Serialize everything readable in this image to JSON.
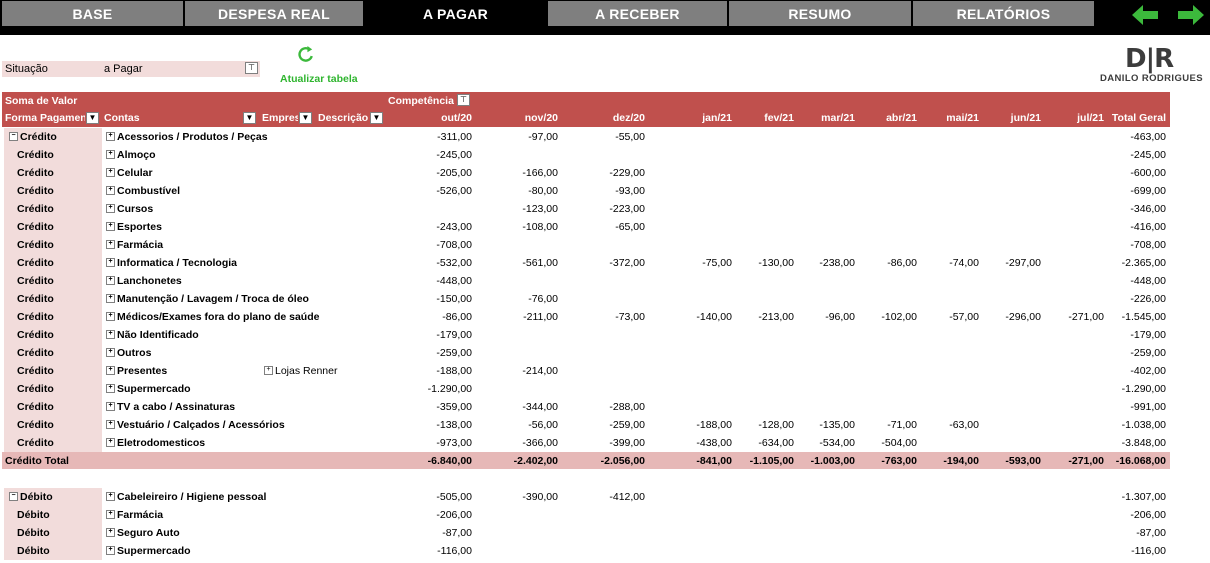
{
  "tabs": [
    {
      "label": "BASE"
    },
    {
      "label": "DESPESA REAL"
    },
    {
      "label": "A PAGAR"
    },
    {
      "label": "A RECEBER"
    },
    {
      "label": "RESUMO"
    },
    {
      "label": "RELATÓRIOS"
    }
  ],
  "nav": {
    "back_icon": "green-arrow-left-icon",
    "forward_icon": "green-arrow-right-icon",
    "color": "#3cb93c"
  },
  "filter": {
    "label": "Situação",
    "value": "a Pagar"
  },
  "refresh": {
    "label": "Atualizar tabela",
    "icon": "refresh-icon"
  },
  "logo": {
    "initials": "D|R",
    "name": "DANILO RODRIGUES"
  },
  "pivot": {
    "value_label": "Soma de Valor",
    "column_field": "Competência",
    "row_headers": {
      "forma": "Forma Pagamento",
      "contas": "Contas",
      "empresa": "Empresa",
      "descricao": "Descrição"
    },
    "months": [
      "out/20",
      "nov/20",
      "dez/20",
      "jan/21",
      "fev/21",
      "mar/21",
      "abr/21",
      "mai/21",
      "jun/21",
      "jul/21"
    ],
    "total_header": "Total Geral",
    "credito_rows": [
      {
        "forma": "Crédito",
        "conta": "Acessorios / Produtos / Peças",
        "empresa": "",
        "vals": [
          "-311,00",
          "-97,00",
          "-55,00",
          "",
          "",
          "",
          "",
          "",
          "",
          ""
        ],
        "total": "-463,00"
      },
      {
        "forma": "Crédito",
        "conta": "Almoço",
        "empresa": "",
        "vals": [
          "-245,00",
          "",
          "",
          "",
          "",
          "",
          "",
          "",
          "",
          ""
        ],
        "total": "-245,00"
      },
      {
        "forma": "Crédito",
        "conta": "Celular",
        "empresa": "",
        "vals": [
          "-205,00",
          "-166,00",
          "-229,00",
          "",
          "",
          "",
          "",
          "",
          "",
          ""
        ],
        "total": "-600,00"
      },
      {
        "forma": "Crédito",
        "conta": "Combustível",
        "empresa": "",
        "vals": [
          "-526,00",
          "-80,00",
          "-93,00",
          "",
          "",
          "",
          "",
          "",
          "",
          ""
        ],
        "total": "-699,00"
      },
      {
        "forma": "Crédito",
        "conta": "Cursos",
        "empresa": "",
        "vals": [
          "",
          "-123,00",
          "-223,00",
          "",
          "",
          "",
          "",
          "",
          "",
          ""
        ],
        "total": "-346,00"
      },
      {
        "forma": "Crédito",
        "conta": "Esportes",
        "empresa": "",
        "vals": [
          "-243,00",
          "-108,00",
          "-65,00",
          "",
          "",
          "",
          "",
          "",
          "",
          ""
        ],
        "total": "-416,00"
      },
      {
        "forma": "Crédito",
        "conta": "Farmácia",
        "empresa": "",
        "vals": [
          "-708,00",
          "",
          "",
          "",
          "",
          "",
          "",
          "",
          "",
          ""
        ],
        "total": "-708,00"
      },
      {
        "forma": "Crédito",
        "conta": "Informatica / Tecnologia",
        "empresa": "",
        "vals": [
          "-532,00",
          "-561,00",
          "-372,00",
          "-75,00",
          "-130,00",
          "-238,00",
          "-86,00",
          "-74,00",
          "-297,00",
          ""
        ],
        "total": "-2.365,00"
      },
      {
        "forma": "Crédito",
        "conta": "Lanchonetes",
        "empresa": "",
        "vals": [
          "-448,00",
          "",
          "",
          "",
          "",
          "",
          "",
          "",
          "",
          ""
        ],
        "total": "-448,00"
      },
      {
        "forma": "Crédito",
        "conta": "Manutenção / Lavagem / Troca de óleo",
        "empresa": "",
        "vals": [
          "-150,00",
          "-76,00",
          "",
          "",
          "",
          "",
          "",
          "",
          "",
          ""
        ],
        "total": "-226,00"
      },
      {
        "forma": "Crédito",
        "conta": "Médicos/Exames fora do plano de saúde",
        "empresa": "",
        "vals": [
          "-86,00",
          "-211,00",
          "-73,00",
          "-140,00",
          "-213,00",
          "-96,00",
          "-102,00",
          "-57,00",
          "-296,00",
          "-271,00"
        ],
        "total": "-1.545,00"
      },
      {
        "forma": "Crédito",
        "conta": "Não Identificado",
        "empresa": "",
        "vals": [
          "-179,00",
          "",
          "",
          "",
          "",
          "",
          "",
          "",
          "",
          ""
        ],
        "total": "-179,00"
      },
      {
        "forma": "Crédito",
        "conta": "Outros",
        "empresa": "",
        "vals": [
          "-259,00",
          "",
          "",
          "",
          "",
          "",
          "",
          "",
          "",
          ""
        ],
        "total": "-259,00"
      },
      {
        "forma": "Crédito",
        "conta": "Presentes",
        "empresa": "Lojas Renner",
        "vals": [
          "-188,00",
          "-214,00",
          "",
          "",
          "",
          "",
          "",
          "",
          "",
          ""
        ],
        "total": "-402,00"
      },
      {
        "forma": "Crédito",
        "conta": "Supermercado",
        "empresa": "",
        "vals": [
          "-1.290,00",
          "",
          "",
          "",
          "",
          "",
          "",
          "",
          "",
          ""
        ],
        "total": "-1.290,00"
      },
      {
        "forma": "Crédito",
        "conta": "TV a cabo / Assinaturas",
        "empresa": "",
        "vals": [
          "-359,00",
          "-344,00",
          "-288,00",
          "",
          "",
          "",
          "",
          "",
          "",
          ""
        ],
        "total": "-991,00"
      },
      {
        "forma": "Crédito",
        "conta": "Vestuário / Calçados / Acessórios",
        "empresa": "",
        "vals": [
          "-138,00",
          "-56,00",
          "-259,00",
          "-188,00",
          "-128,00",
          "-135,00",
          "-71,00",
          "-63,00",
          "",
          ""
        ],
        "total": "-1.038,00"
      },
      {
        "forma": "Crédito",
        "conta": "Eletrodomesticos",
        "empresa": "",
        "vals": [
          "-973,00",
          "-366,00",
          "-399,00",
          "-438,00",
          "-634,00",
          "-534,00",
          "-504,00",
          "",
          "",
          ""
        ],
        "total": "-3.848,00"
      }
    ],
    "credito_total": {
      "label": "Crédito Total",
      "vals": [
        "-6.840,00",
        "-2.402,00",
        "-2.056,00",
        "-841,00",
        "-1.105,00",
        "-1.003,00",
        "-763,00",
        "-194,00",
        "-593,00",
        "-271,00"
      ],
      "total": "-16.068,00"
    },
    "debito_rows": [
      {
        "forma": "Débito",
        "conta": "Cabeleireiro / Higiene pessoal",
        "empresa": "",
        "vals": [
          "-505,00",
          "-390,00",
          "-412,00",
          "",
          "",
          "",
          "",
          "",
          "",
          ""
        ],
        "total": "-1.307,00"
      },
      {
        "forma": "Débito",
        "conta": "Farmácia",
        "empresa": "",
        "vals": [
          "-206,00",
          "",
          "",
          "",
          "",
          "",
          "",
          "",
          "",
          ""
        ],
        "total": "-206,00"
      },
      {
        "forma": "Débito",
        "conta": "Seguro Auto",
        "empresa": "",
        "vals": [
          "-87,00",
          "",
          "",
          "",
          "",
          "",
          "",
          "",
          "",
          ""
        ],
        "total": "-87,00"
      },
      {
        "forma": "Débito",
        "conta": "Supermercado",
        "empresa": "",
        "vals": [
          "-116,00",
          "",
          "",
          "",
          "",
          "",
          "",
          "",
          "",
          ""
        ],
        "total": "-116,00"
      }
    ]
  }
}
